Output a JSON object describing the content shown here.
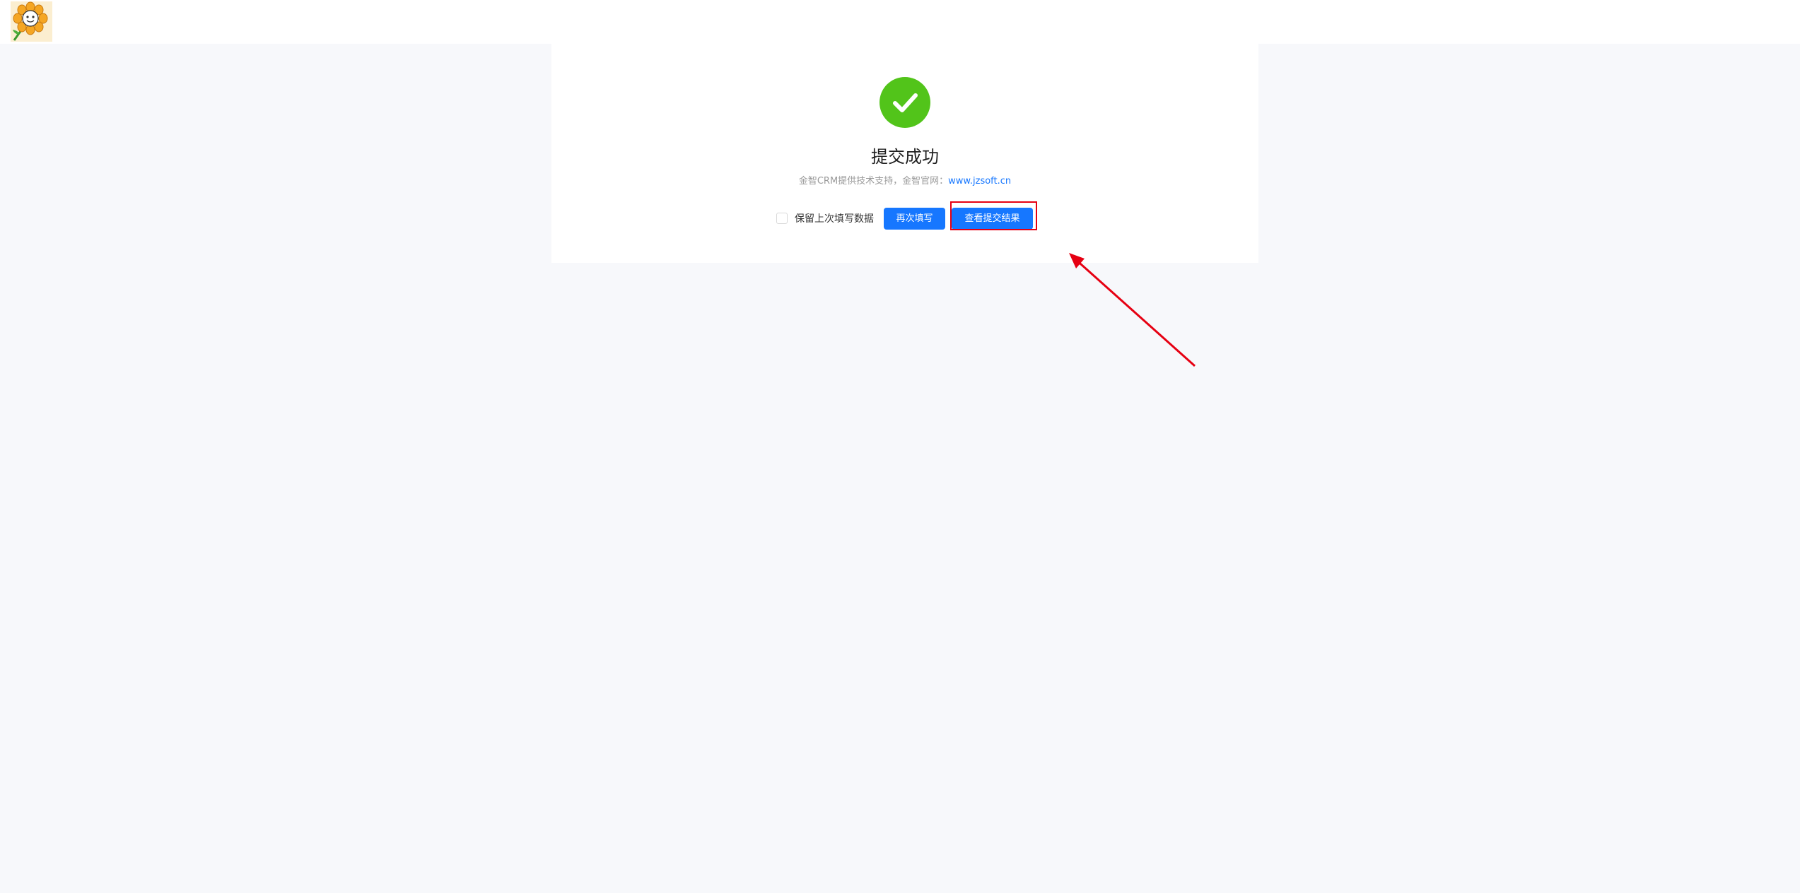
{
  "result": {
    "title": "提交成功",
    "subtitle_prefix": "金智CRM提供技术支持，金智官网：",
    "subtitle_link": "www.jzsoft.cn"
  },
  "actions": {
    "keep_data_label": "保留上次填写数据",
    "keep_data_checked": false,
    "refill_label": "再次填写",
    "view_result_label": "查看提交结果"
  },
  "colors": {
    "success": "#52c41a",
    "primary": "#1677ff",
    "highlight": "#e60012"
  },
  "icons": {
    "logo": "sunflower-logo-icon",
    "success": "check-circle-icon",
    "annotation": "red-arrow-icon"
  }
}
